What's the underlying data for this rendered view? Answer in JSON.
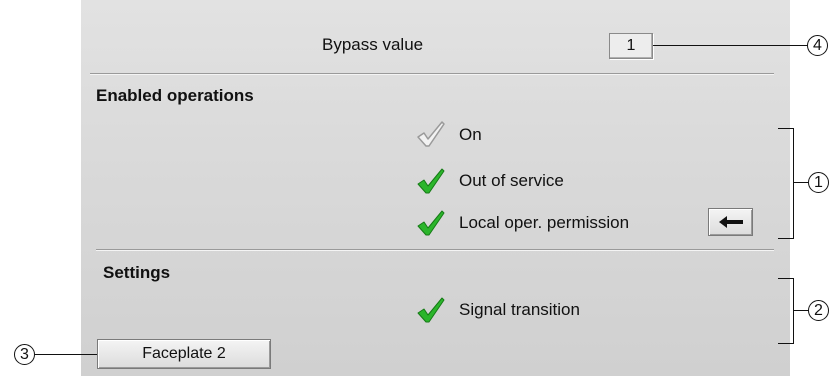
{
  "bypass": {
    "label": "Bypass value",
    "value": "1"
  },
  "enabled_operations": {
    "title": "Enabled operations",
    "items": [
      {
        "label": "On",
        "state": "inactive"
      },
      {
        "label": "Out of service",
        "state": "enabled"
      },
      {
        "label": "Local oper. permission",
        "state": "enabled",
        "has_navigation_button": true
      }
    ]
  },
  "settings": {
    "title": "Settings",
    "items": [
      {
        "label": "Signal transition",
        "state": "enabled"
      }
    ]
  },
  "faceplate_button": {
    "label": "Faceplate 2"
  },
  "callouts": [
    "1",
    "2",
    "3",
    "4"
  ],
  "colors": {
    "check_enabled": "#1fa81f",
    "check_inactive": "#a8a8a8",
    "panel_background": "#d9d9d9"
  },
  "icons": {
    "enabled": "checkmark-icon",
    "inactive": "checkmark-outline-icon",
    "navigation": "arrow-left-icon"
  }
}
